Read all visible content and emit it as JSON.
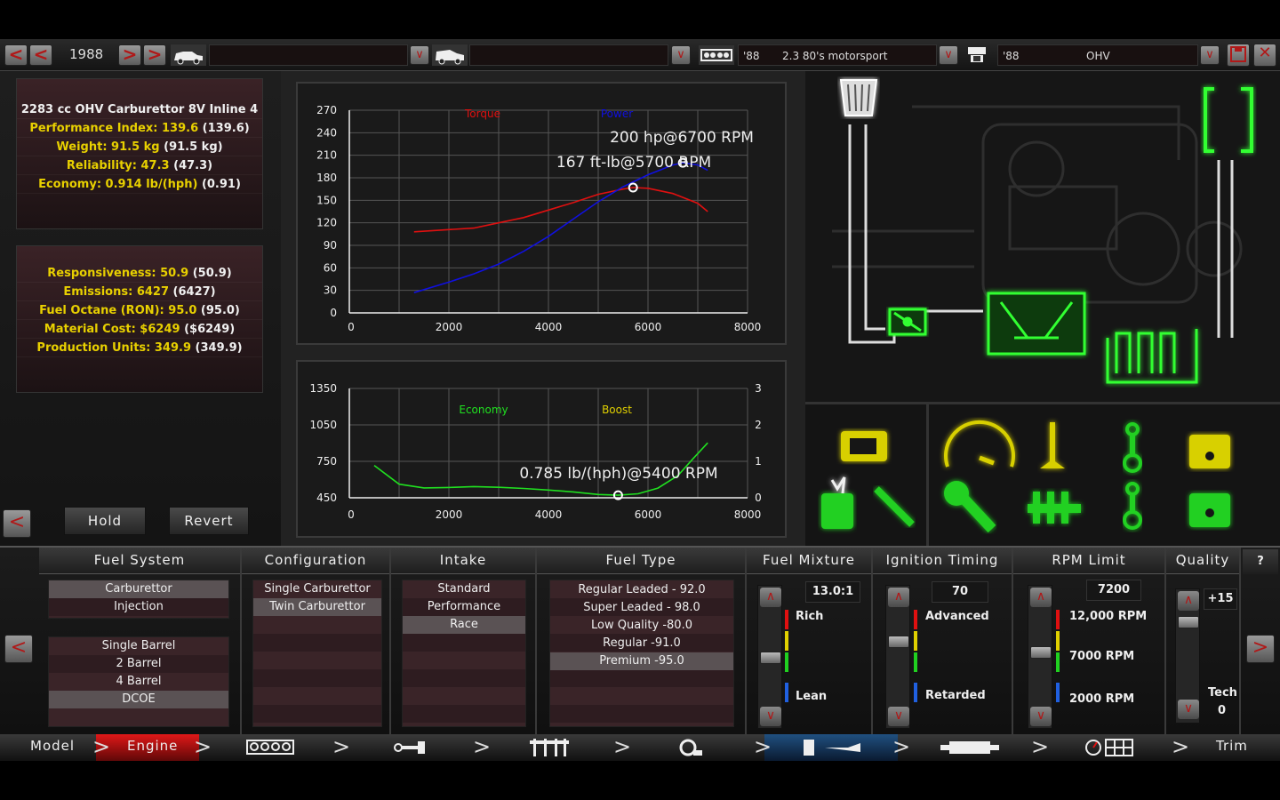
{
  "top": {
    "year": "1988",
    "block": {
      "year": "'88",
      "name": "2.3 80's motorsport"
    },
    "head": {
      "year": "'88",
      "name": "OHV"
    }
  },
  "stats1": [
    {
      "label": "2283 cc OHV Carburettor 8V Inline 4",
      "val": ""
    },
    {
      "label": "Performance Index: 139.6",
      "val": "(139.6)"
    },
    {
      "label": "Weight: 91.5 kg",
      "val": "(91.5 kg)"
    },
    {
      "label": "Reliability: 47.3",
      "val": "(47.3)"
    },
    {
      "label": "Economy: 0.914 lb/(hph)",
      "val": "(0.91)"
    }
  ],
  "stats2": [
    {
      "label": "Responsiveness: 50.9",
      "val": "(50.9)"
    },
    {
      "label": "Emissions: 6427",
      "val": "(6427)"
    },
    {
      "label": "Fuel Octane (RON): 95.0",
      "val": "(95.0)"
    },
    {
      "label": "Material Cost: $6249",
      "val": "($6249)"
    },
    {
      "label": "Production Units: 349.9",
      "val": "(349.9)"
    }
  ],
  "buttons": {
    "hold": "Hold",
    "revert": "Revert"
  },
  "chart_data": [
    {
      "type": "line",
      "x_ticks": [
        "0",
        "2000",
        "4000",
        "6000",
        "8000"
      ],
      "y_ticks": [
        "0",
        "30",
        "60",
        "90",
        "120",
        "150",
        "180",
        "210",
        "240",
        "270"
      ],
      "xlim": [
        0,
        8000
      ],
      "ylim": [
        0,
        270
      ],
      "series": [
        {
          "name": "Torque",
          "color": "#e01010",
          "x": [
            1300,
            2000,
            2500,
            3000,
            3500,
            4000,
            4500,
            5000,
            5500,
            5700,
            6000,
            6500,
            7000,
            7200
          ],
          "y": [
            108,
            111,
            113,
            120,
            127,
            137,
            147,
            158,
            165,
            167,
            166,
            159,
            146,
            135
          ]
        },
        {
          "name": "Power",
          "color": "#1010e0",
          "x": [
            1300,
            2000,
            2500,
            3000,
            3500,
            4000,
            4500,
            5000,
            5500,
            6000,
            6500,
            6700,
            7000,
            7200
          ],
          "y": [
            27,
            41,
            52,
            65,
            82,
            102,
            125,
            148,
            168,
            184,
            197,
            200,
            197,
            190
          ]
        }
      ],
      "annotations": [
        "200 hp@6700 RPM",
        "167 ft-lb@5700 RPM"
      ],
      "markers": [
        {
          "x": 6700,
          "y": 200
        },
        {
          "x": 5700,
          "y": 167
        }
      ]
    },
    {
      "type": "line",
      "x_ticks": [
        "0",
        "2000",
        "4000",
        "6000",
        "8000"
      ],
      "y_ticks": [
        "450",
        "750",
        "1050",
        "1350"
      ],
      "y2_ticks": [
        "0",
        "1",
        "2",
        "3"
      ],
      "xlim": [
        0,
        8000
      ],
      "ylim": [
        450,
        1350
      ],
      "series": [
        {
          "name": "Economy",
          "color": "#20e020",
          "x": [
            500,
            1000,
            1500,
            2000,
            2500,
            3000,
            3500,
            4000,
            4500,
            5000,
            5400,
            5800,
            6200,
            6600,
            6900,
            7200
          ],
          "y": [
            716,
            562,
            531,
            535,
            542,
            536,
            527,
            514,
            498,
            477,
            471,
            483,
            530,
            632,
            770,
            902
          ]
        },
        {
          "name": "Boost",
          "color": "#e0d000",
          "x": [],
          "y": []
        }
      ],
      "annotations": [
        "0.785 lb/(hph)@5400 RPM"
      ],
      "markers": [
        {
          "x": 5400,
          "y": 471
        }
      ]
    }
  ],
  "columns": {
    "fuel_system": {
      "title": "Fuel System",
      "types": [
        "Carburettor",
        "Injection"
      ],
      "barrels": [
        "Single Barrel",
        "2 Barrel",
        "4 Barrel",
        "DCOE"
      ]
    },
    "configuration": {
      "title": "Configuration",
      "items": [
        "Single Carburettor",
        "Twin Carburettor"
      ]
    },
    "intake": {
      "title": "Intake",
      "items": [
        "Standard",
        "Performance",
        "Race"
      ]
    },
    "fuel_type": {
      "title": "Fuel Type",
      "items": [
        "Regular Leaded - 92.0",
        "Super Leaded - 98.0",
        "Low Quality -80.0",
        "Regular -91.0",
        "Premium -95.0"
      ]
    },
    "fuel_mixture": {
      "title": "Fuel Mixture",
      "value": "13.0:1",
      "top": "Rich",
      "bottom": "Lean"
    },
    "ignition": {
      "title": "Ignition Timing",
      "value": "70",
      "top": "Advanced",
      "bottom": "Retarded"
    },
    "rpm": {
      "title": "RPM Limit",
      "value": "7200",
      "top": "12,000 RPM",
      "mid": "7000 RPM",
      "bottom": "2000 RPM"
    },
    "quality": {
      "title": "Quality",
      "value": "+15",
      "tech_label": "Tech",
      "tech": "0"
    },
    "help": "?"
  },
  "nav": {
    "model": "Model",
    "engine": "Engine",
    "trim": "Trim"
  },
  "colors": {
    "glow_green": "#30ff30",
    "glow_yellow": "#f0e020",
    "accent_red": "#b01818"
  }
}
